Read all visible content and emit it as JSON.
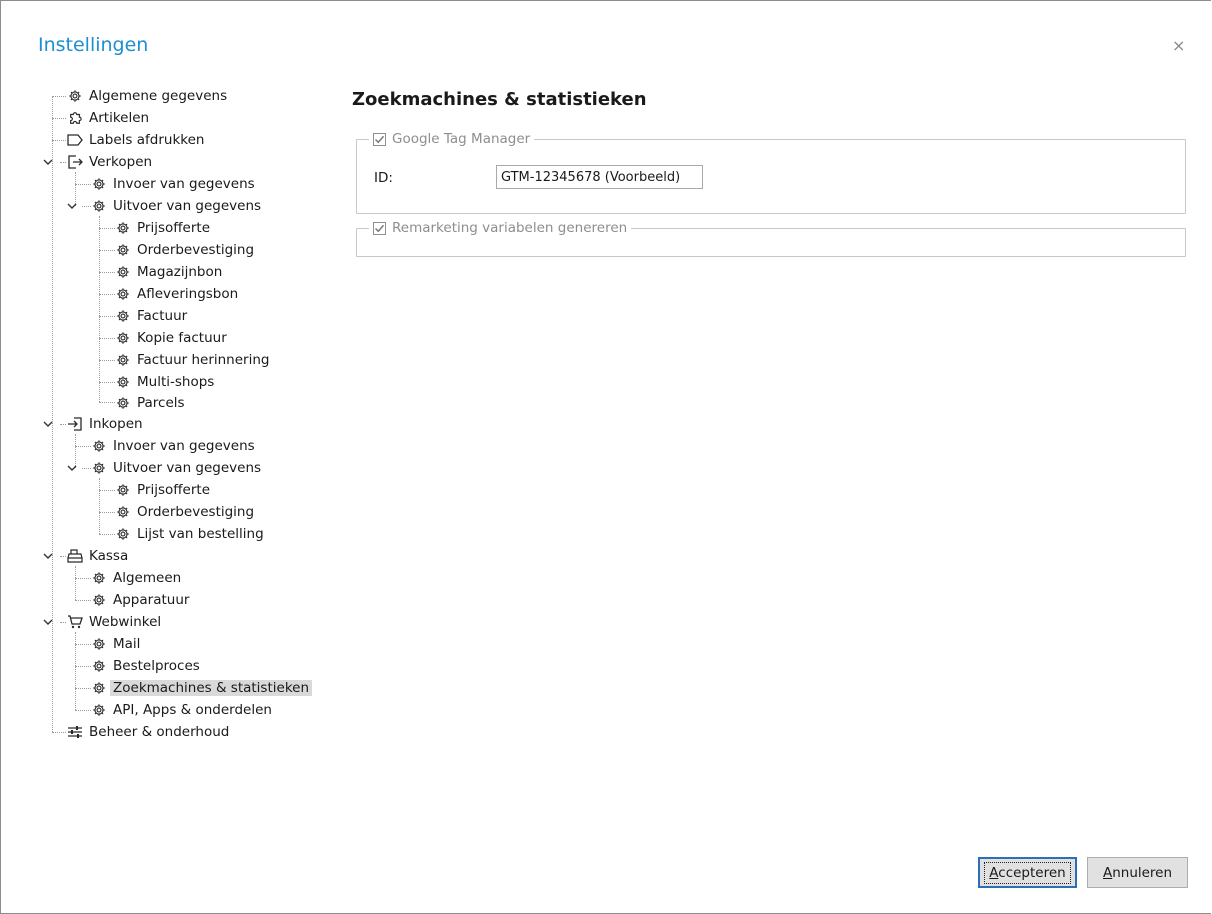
{
  "dialog": {
    "title": "Instellingen",
    "close_glyph": "×"
  },
  "tree": {
    "algemene": "Algemene gegevens",
    "artikelen": "Artikelen",
    "labels": "Labels afdrukken",
    "verkopen": "Verkopen",
    "verkopen_invoer": "Invoer van gegevens",
    "verkopen_uitvoer": "Uitvoer van gegevens",
    "v_prijsofferte": "Prijsofferte",
    "v_orderbevestiging": "Orderbevestiging",
    "v_magazijnbon": "Magazijnbon",
    "v_afleveringsbon": "Afleveringsbon",
    "v_factuur": "Factuur",
    "v_kopie_factuur": "Kopie factuur",
    "v_factuur_herinnering": "Factuur herinnering",
    "v_multishops": "Multi-shops",
    "v_parcels": "Parcels",
    "inkopen": "Inkopen",
    "inkopen_invoer": "Invoer van gegevens",
    "inkopen_uitvoer": "Uitvoer van gegevens",
    "i_prijsofferte": "Prijsofferte",
    "i_orderbevestiging": "Orderbevestiging",
    "i_lijst": "Lijst van bestelling",
    "kassa": "Kassa",
    "k_algemeen": "Algemeen",
    "k_apparatuur": "Apparatuur",
    "webwinkel": "Webwinkel",
    "w_mail": "Mail",
    "w_bestelproces": "Bestelproces",
    "w_zoekmachines": "Zoekmachines & statistieken",
    "w_api": "API, Apps & onderdelen",
    "beheer": "Beheer & onderhoud"
  },
  "panel": {
    "heading": "Zoekmachines & statistieken",
    "gtm": {
      "label": "Google Tag Manager",
      "checked": true,
      "id_label": "ID:",
      "id_value": "GTM-12345678 (Voorbeeld)"
    },
    "remarketing": {
      "label": "Remarketing variabelen genereren",
      "checked": true
    }
  },
  "buttons": {
    "accept_pre": "",
    "accept_u": "A",
    "accept_post": "ccepteren",
    "cancel_pre": "",
    "cancel_u": "A",
    "cancel_post": "nnuleren"
  },
  "icons": {
    "gear": "gear-icon",
    "puzzle": "puzzle-icon",
    "label": "label-tag-icon",
    "exit": "sales-export-icon",
    "enter": "purchase-import-icon",
    "register": "cash-register-icon",
    "cart": "cart-icon",
    "sliders": "sliders-icon",
    "chevron": "chevron-down-icon",
    "check": "check-icon"
  }
}
